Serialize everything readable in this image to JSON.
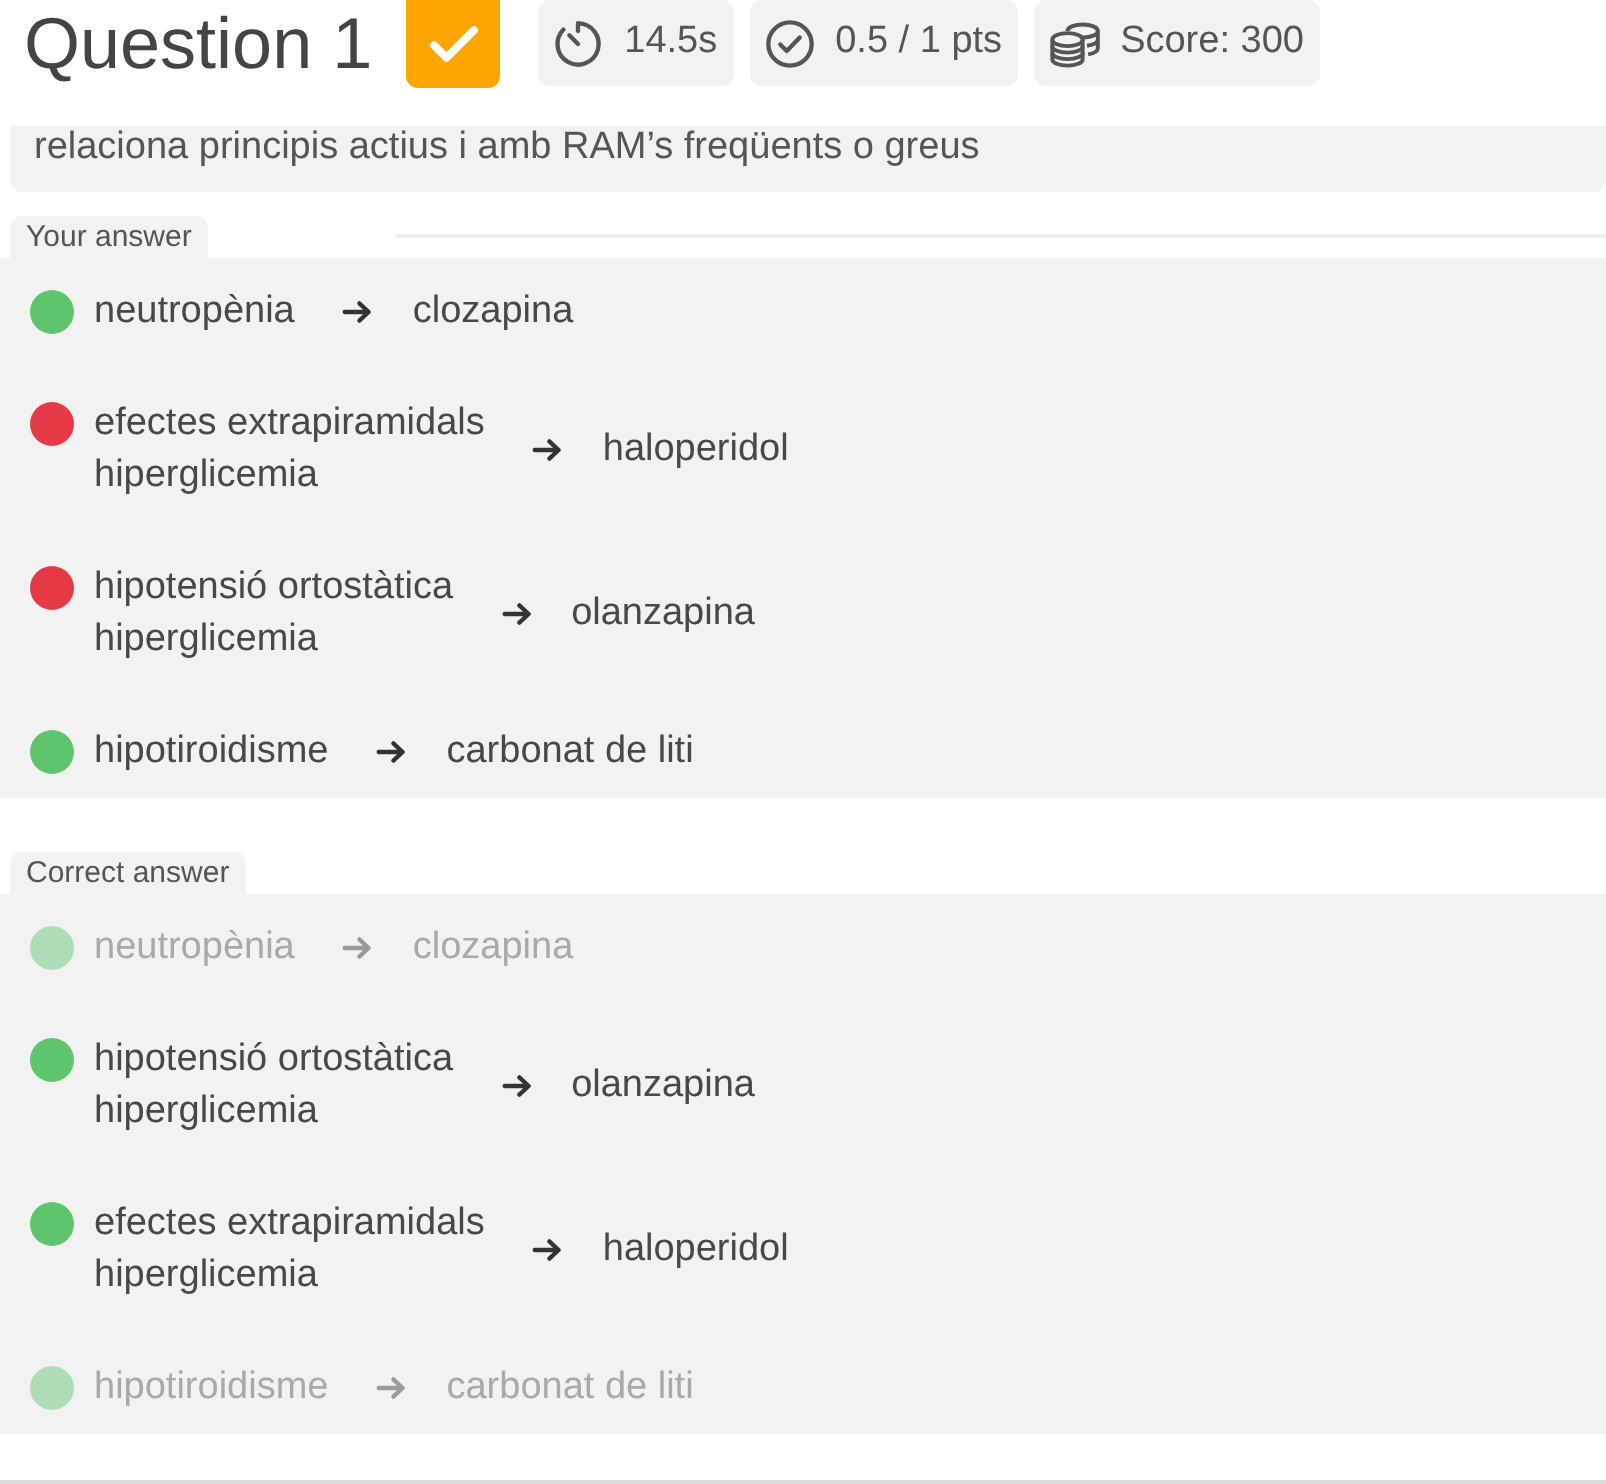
{
  "header": {
    "title": "Question 1",
    "result": {
      "checked": true
    },
    "stats": [
      {
        "kind": "time",
        "text": "14.5s"
      },
      {
        "kind": "points",
        "text": "0.5 / 1 pts"
      },
      {
        "kind": "score",
        "text": "Score: 300"
      }
    ]
  },
  "question": {
    "text": "relaciona principis actius i amb RAM’s freqüents o greus"
  },
  "sections": [
    {
      "label": "Your answer",
      "pairs": [
        {
          "left": [
            "neutropènia"
          ],
          "right": "clozapina",
          "color": "#5ec46e",
          "dimmed": false
        },
        {
          "left": [
            "efectes extrapiramidals",
            "hiperglicemia"
          ],
          "right": "haloperidol",
          "color": "#e63946",
          "dimmed": false
        },
        {
          "left": [
            "hipotensió ortostàtica",
            "hiperglicemia"
          ],
          "right": "olanzapina",
          "color": "#e63946",
          "dimmed": false
        },
        {
          "left": [
            "hipotiroidisme"
          ],
          "right": "carbonat de liti",
          "color": "#5ec46e",
          "dimmed": false
        }
      ]
    },
    {
      "label": "Correct answer",
      "pairs": [
        {
          "left": [
            "neutropènia"
          ],
          "right": "clozapina",
          "color": "#aedcb6",
          "dimmed": true
        },
        {
          "left": [
            "hipotensió ortostàtica",
            "hiperglicemia"
          ],
          "right": "olanzapina",
          "color": "#5ec46e",
          "dimmed": false
        },
        {
          "left": [
            "efectes extrapiramidals",
            "hiperglicemia"
          ],
          "right": "haloperidol",
          "color": "#5ec46e",
          "dimmed": false
        },
        {
          "left": [
            "hipotiroidisme"
          ],
          "right": "carbonat de liti",
          "color": "#aedcb6",
          "dimmed": true
        }
      ]
    }
  ]
}
